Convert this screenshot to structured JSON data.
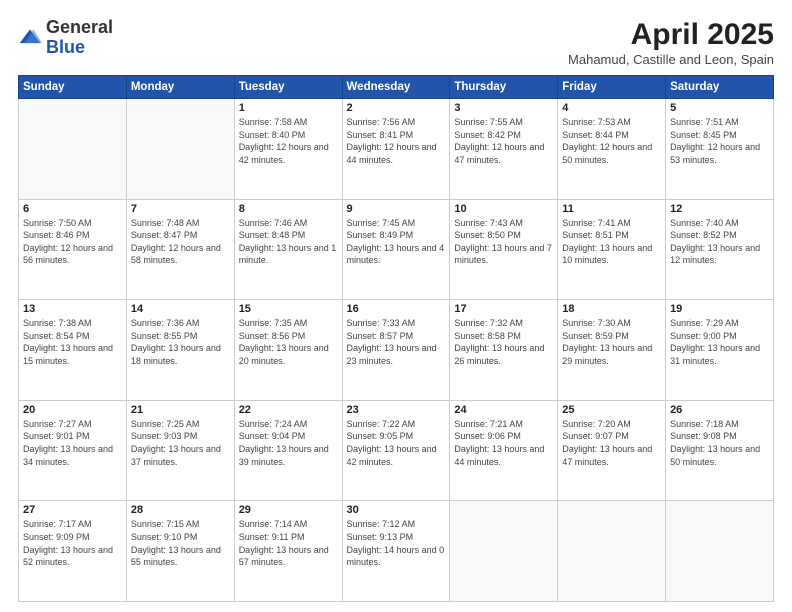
{
  "header": {
    "logo_general": "General",
    "logo_blue": "Blue",
    "main_title": "April 2025",
    "subtitle": "Mahamud, Castille and Leon, Spain"
  },
  "days_of_week": [
    "Sunday",
    "Monday",
    "Tuesday",
    "Wednesday",
    "Thursday",
    "Friday",
    "Saturday"
  ],
  "weeks": [
    [
      {
        "day": "",
        "detail": ""
      },
      {
        "day": "",
        "detail": ""
      },
      {
        "day": "1",
        "detail": "Sunrise: 7:58 AM\nSunset: 8:40 PM\nDaylight: 12 hours and 42 minutes."
      },
      {
        "day": "2",
        "detail": "Sunrise: 7:56 AM\nSunset: 8:41 PM\nDaylight: 12 hours and 44 minutes."
      },
      {
        "day": "3",
        "detail": "Sunrise: 7:55 AM\nSunset: 8:42 PM\nDaylight: 12 hours and 47 minutes."
      },
      {
        "day": "4",
        "detail": "Sunrise: 7:53 AM\nSunset: 8:44 PM\nDaylight: 12 hours and 50 minutes."
      },
      {
        "day": "5",
        "detail": "Sunrise: 7:51 AM\nSunset: 8:45 PM\nDaylight: 12 hours and 53 minutes."
      }
    ],
    [
      {
        "day": "6",
        "detail": "Sunrise: 7:50 AM\nSunset: 8:46 PM\nDaylight: 12 hours and 56 minutes."
      },
      {
        "day": "7",
        "detail": "Sunrise: 7:48 AM\nSunset: 8:47 PM\nDaylight: 12 hours and 58 minutes."
      },
      {
        "day": "8",
        "detail": "Sunrise: 7:46 AM\nSunset: 8:48 PM\nDaylight: 13 hours and 1 minute."
      },
      {
        "day": "9",
        "detail": "Sunrise: 7:45 AM\nSunset: 8:49 PM\nDaylight: 13 hours and 4 minutes."
      },
      {
        "day": "10",
        "detail": "Sunrise: 7:43 AM\nSunset: 8:50 PM\nDaylight: 13 hours and 7 minutes."
      },
      {
        "day": "11",
        "detail": "Sunrise: 7:41 AM\nSunset: 8:51 PM\nDaylight: 13 hours and 10 minutes."
      },
      {
        "day": "12",
        "detail": "Sunrise: 7:40 AM\nSunset: 8:52 PM\nDaylight: 13 hours and 12 minutes."
      }
    ],
    [
      {
        "day": "13",
        "detail": "Sunrise: 7:38 AM\nSunset: 8:54 PM\nDaylight: 13 hours and 15 minutes."
      },
      {
        "day": "14",
        "detail": "Sunrise: 7:36 AM\nSunset: 8:55 PM\nDaylight: 13 hours and 18 minutes."
      },
      {
        "day": "15",
        "detail": "Sunrise: 7:35 AM\nSunset: 8:56 PM\nDaylight: 13 hours and 20 minutes."
      },
      {
        "day": "16",
        "detail": "Sunrise: 7:33 AM\nSunset: 8:57 PM\nDaylight: 13 hours and 23 minutes."
      },
      {
        "day": "17",
        "detail": "Sunrise: 7:32 AM\nSunset: 8:58 PM\nDaylight: 13 hours and 26 minutes."
      },
      {
        "day": "18",
        "detail": "Sunrise: 7:30 AM\nSunset: 8:59 PM\nDaylight: 13 hours and 29 minutes."
      },
      {
        "day": "19",
        "detail": "Sunrise: 7:29 AM\nSunset: 9:00 PM\nDaylight: 13 hours and 31 minutes."
      }
    ],
    [
      {
        "day": "20",
        "detail": "Sunrise: 7:27 AM\nSunset: 9:01 PM\nDaylight: 13 hours and 34 minutes."
      },
      {
        "day": "21",
        "detail": "Sunrise: 7:25 AM\nSunset: 9:03 PM\nDaylight: 13 hours and 37 minutes."
      },
      {
        "day": "22",
        "detail": "Sunrise: 7:24 AM\nSunset: 9:04 PM\nDaylight: 13 hours and 39 minutes."
      },
      {
        "day": "23",
        "detail": "Sunrise: 7:22 AM\nSunset: 9:05 PM\nDaylight: 13 hours and 42 minutes."
      },
      {
        "day": "24",
        "detail": "Sunrise: 7:21 AM\nSunset: 9:06 PM\nDaylight: 13 hours and 44 minutes."
      },
      {
        "day": "25",
        "detail": "Sunrise: 7:20 AM\nSunset: 9:07 PM\nDaylight: 13 hours and 47 minutes."
      },
      {
        "day": "26",
        "detail": "Sunrise: 7:18 AM\nSunset: 9:08 PM\nDaylight: 13 hours and 50 minutes."
      }
    ],
    [
      {
        "day": "27",
        "detail": "Sunrise: 7:17 AM\nSunset: 9:09 PM\nDaylight: 13 hours and 52 minutes."
      },
      {
        "day": "28",
        "detail": "Sunrise: 7:15 AM\nSunset: 9:10 PM\nDaylight: 13 hours and 55 minutes."
      },
      {
        "day": "29",
        "detail": "Sunrise: 7:14 AM\nSunset: 9:11 PM\nDaylight: 13 hours and 57 minutes."
      },
      {
        "day": "30",
        "detail": "Sunrise: 7:12 AM\nSunset: 9:13 PM\nDaylight: 14 hours and 0 minutes."
      },
      {
        "day": "",
        "detail": ""
      },
      {
        "day": "",
        "detail": ""
      },
      {
        "day": "",
        "detail": ""
      }
    ]
  ]
}
